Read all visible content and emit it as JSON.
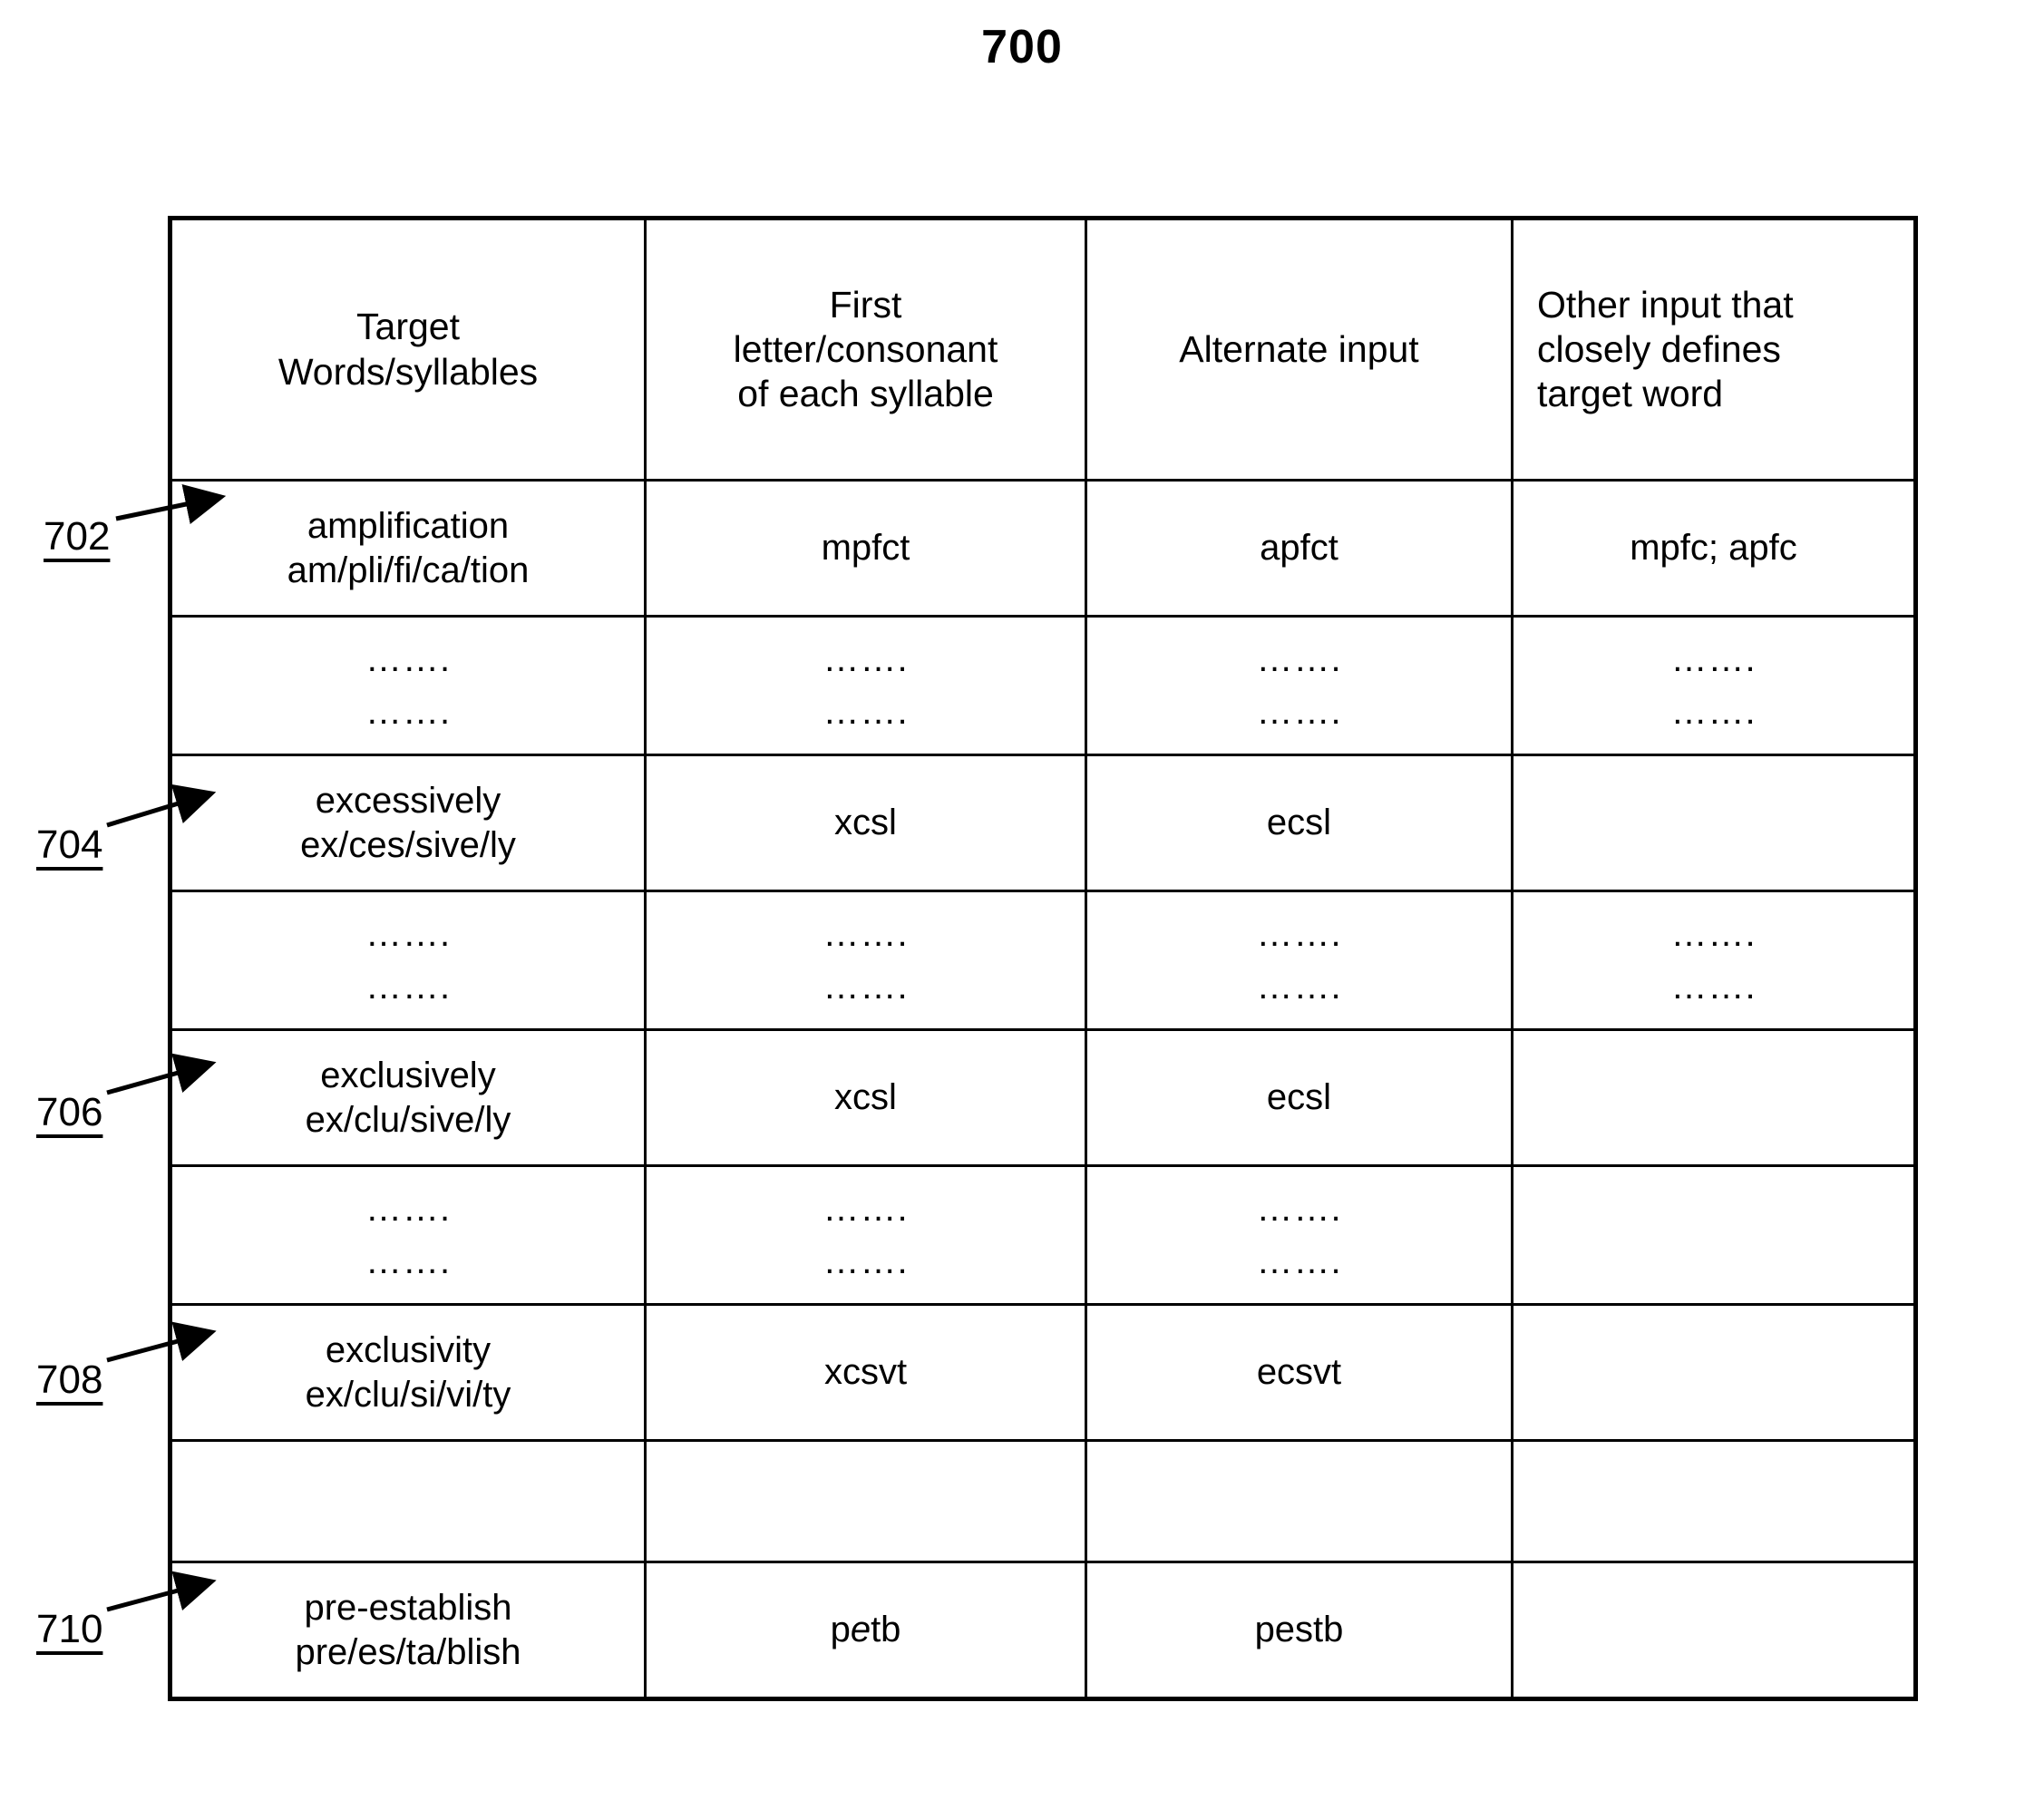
{
  "figure": {
    "number": "700"
  },
  "table": {
    "headers": [
      {
        "lines": [
          "Target",
          "Words/syllables"
        ],
        "align": "center"
      },
      {
        "lines": [
          "First",
          "letter/consonant",
          "of each syllable"
        ],
        "align": "center"
      },
      {
        "lines": [
          "Alternate input"
        ],
        "align": "center"
      },
      {
        "lines": [
          "Other input that",
          "closely defines",
          "target word"
        ],
        "align": "left"
      }
    ],
    "rows": [
      {
        "type": "word",
        "callout": "702",
        "target_word": "amplification",
        "target_syllables": "am/pli/fi/ca/tion",
        "first_letters": "mpfct",
        "alternate_input": "apfct",
        "other_input": "mpfc; apfc"
      },
      {
        "type": "dots",
        "dots": [
          "…….",
          "…….",
          "…….",
          "…….",
          "…….",
          "…….",
          "…….",
          "……."
        ],
        "columns": [
          true,
          true,
          true,
          true
        ]
      },
      {
        "type": "word",
        "callout": "704",
        "target_word": "excessively",
        "target_syllables": "ex/ces/sive/ly",
        "first_letters": "xcsl",
        "alternate_input": "ecsl",
        "other_input": ""
      },
      {
        "type": "dots",
        "dots": [
          "…….",
          "…….",
          "…….",
          "…….",
          "…….",
          "…….",
          "…….",
          "……."
        ],
        "columns": [
          true,
          true,
          true,
          true
        ]
      },
      {
        "type": "word",
        "callout": "706",
        "target_word": "exclusively",
        "target_syllables": "ex/clu/sive/ly",
        "first_letters": "xcsl",
        "alternate_input": "ecsl",
        "other_input": ""
      },
      {
        "type": "dots",
        "dots": [
          "…….",
          "…….",
          "…….",
          "…….",
          "…….",
          "……."
        ],
        "columns": [
          true,
          true,
          true,
          false
        ]
      },
      {
        "type": "word",
        "callout": "708",
        "target_word": "exclusivity",
        "target_syllables": "ex/clu/si/vi/ty",
        "first_letters": "xcsvt",
        "alternate_input": "ecsvt",
        "other_input": ""
      },
      {
        "type": "blank",
        "columns": [
          false,
          false,
          false,
          false
        ]
      },
      {
        "type": "word",
        "callout": "710",
        "target_word": "pre-establish",
        "target_syllables": "pre/es/ta/blish",
        "first_letters_pre": "p",
        "first_letters_italic": "e",
        "first_letters_post": "tb",
        "first_letters": "petb",
        "alternate_input": "pestb",
        "other_input": ""
      }
    ]
  },
  "callouts": [
    {
      "label": "702"
    },
    {
      "label": "704"
    },
    {
      "label": "706"
    },
    {
      "label": "708"
    },
    {
      "label": "710"
    }
  ],
  "colors": {
    "ink": "#000000",
    "paper": "#ffffff"
  }
}
